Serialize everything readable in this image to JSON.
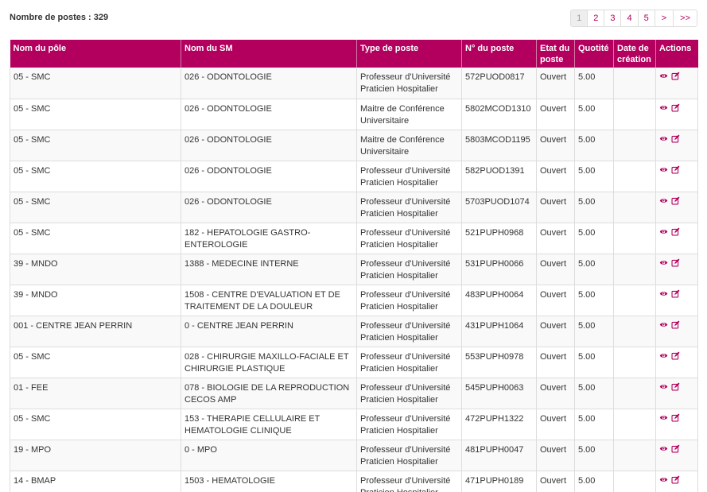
{
  "header": {
    "count_label": "Nombre de postes : 329"
  },
  "pagination": {
    "items": [
      "1",
      "2",
      "3",
      "4",
      "5",
      ">",
      ">>"
    ],
    "active_index": 0
  },
  "colors": {
    "accent": "#b3005e",
    "row_alt": "#f9f9f9"
  },
  "table": {
    "columns": [
      "Nom du pôle",
      "Nom du SM",
      "Type de poste",
      "N° du poste",
      "Etat du poste",
      "Quotité",
      "Date de création",
      "Actions"
    ],
    "action_icons": [
      "eye-icon",
      "edit-icon"
    ],
    "rows": [
      {
        "pole": "05 - SMC",
        "sm": "026 - ODONTOLOGIE",
        "type": "Professeur d'Université Praticien Hospitalier",
        "num": "572PUOD0817",
        "etat": "Ouvert",
        "quotite": "5.00",
        "date": ""
      },
      {
        "pole": "05 - SMC",
        "sm": "026 - ODONTOLOGIE",
        "type": "Maitre de Conférence Universitaire",
        "num": "5802MCOD1310",
        "etat": "Ouvert",
        "quotite": "5.00",
        "date": ""
      },
      {
        "pole": "05 - SMC",
        "sm": "026 - ODONTOLOGIE",
        "type": "Maitre de Conférence Universitaire",
        "num": "5803MCOD1195",
        "etat": "Ouvert",
        "quotite": "5.00",
        "date": ""
      },
      {
        "pole": "05 - SMC",
        "sm": "026 - ODONTOLOGIE",
        "type": "Professeur d'Université Praticien Hospitalier",
        "num": "582PUOD1391",
        "etat": "Ouvert",
        "quotite": "5.00",
        "date": ""
      },
      {
        "pole": "05 - SMC",
        "sm": "026 - ODONTOLOGIE",
        "type": "Professeur d'Université Praticien Hospitalier",
        "num": "5703PUOD1074",
        "etat": "Ouvert",
        "quotite": "5.00",
        "date": ""
      },
      {
        "pole": "05 - SMC",
        "sm": "182 - HEPATOLOGIE GASTRO-ENTEROLOGIE",
        "type": "Professeur d'Université Praticien Hospitalier",
        "num": "521PUPH0968",
        "etat": "Ouvert",
        "quotite": "5.00",
        "date": ""
      },
      {
        "pole": "39 - MNDO",
        "sm": "1388 - MEDECINE INTERNE",
        "type": "Professeur d'Université Praticien Hospitalier",
        "num": "531PUPH0066",
        "etat": "Ouvert",
        "quotite": "5.00",
        "date": ""
      },
      {
        "pole": "39 - MNDO",
        "sm": "1508 - CENTRE D'EVALUATION ET DE TRAITEMENT DE LA DOULEUR",
        "type": "Professeur d'Université Praticien Hospitalier",
        "num": "483PUPH0064",
        "etat": "Ouvert",
        "quotite": "5.00",
        "date": ""
      },
      {
        "pole": "001 - CENTRE JEAN PERRIN",
        "sm": "0 - CENTRE JEAN PERRIN",
        "type": "Professeur d'Université Praticien Hospitalier",
        "num": "431PUPH1064",
        "etat": "Ouvert",
        "quotite": "5.00",
        "date": ""
      },
      {
        "pole": "05 - SMC",
        "sm": "028 - CHIRURGIE MAXILLO-FACIALE ET CHIRURGIE PLASTIQUE",
        "type": "Professeur d'Université Praticien Hospitalier",
        "num": "553PUPH0978",
        "etat": "Ouvert",
        "quotite": "5.00",
        "date": ""
      },
      {
        "pole": "01 - FEE",
        "sm": "078 - BIOLOGIE DE LA REPRODUCTION CECOS AMP",
        "type": "Professeur d'Université Praticien Hospitalier",
        "num": "545PUPH0063",
        "etat": "Ouvert",
        "quotite": "5.00",
        "date": ""
      },
      {
        "pole": "05 - SMC",
        "sm": "153 - THERAPIE CELLULAIRE ET HEMATOLOGIE CLINIQUE",
        "type": "Professeur d'Université Praticien Hospitalier",
        "num": "472PUPH1322",
        "etat": "Ouvert",
        "quotite": "5.00",
        "date": ""
      },
      {
        "pole": "19 - MPO",
        "sm": "0 - MPO",
        "type": "Professeur d'Université Praticien Hospitalier",
        "num": "481PUPH0047",
        "etat": "Ouvert",
        "quotite": "5.00",
        "date": ""
      },
      {
        "pole": "14 - BMAP",
        "sm": "1503 - HEMATOLOGIE",
        "type": "Professeur d'Université Praticien Hospitalier",
        "num": "471PUPH0189",
        "etat": "Ouvert",
        "quotite": "5.00",
        "date": ""
      }
    ]
  }
}
